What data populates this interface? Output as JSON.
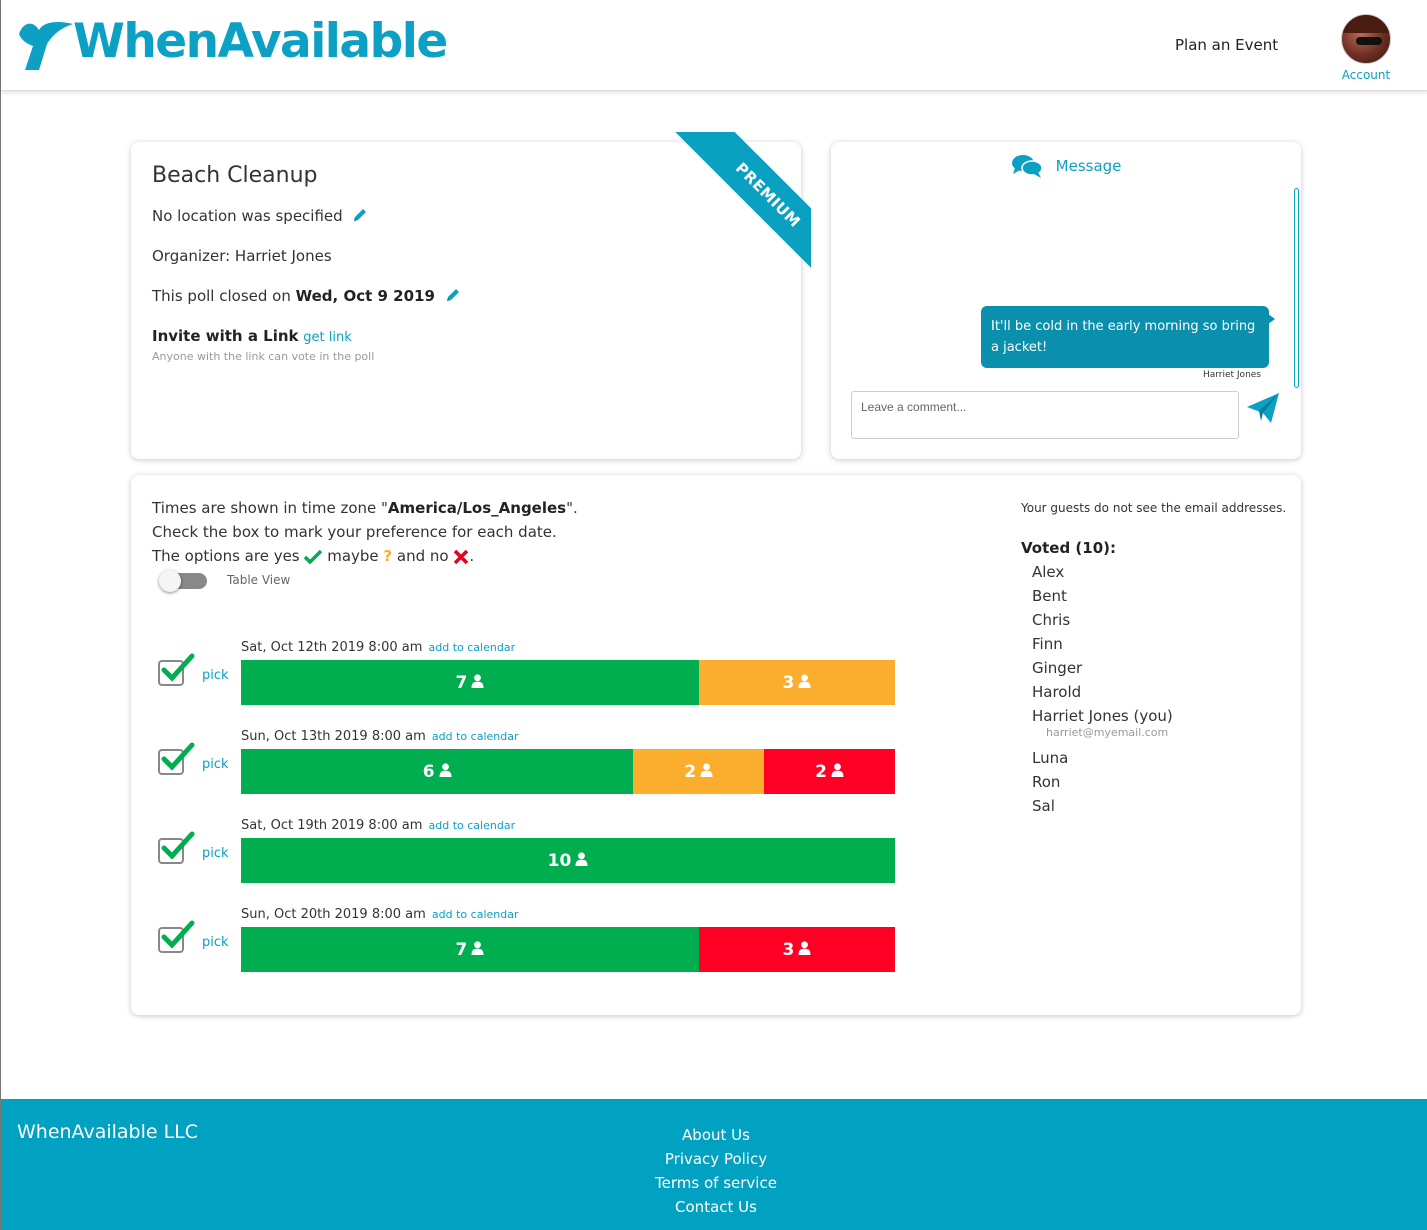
{
  "header": {
    "brand": "WhenAvailable",
    "nav_plan": "Plan an Event",
    "account_label": "Account"
  },
  "event": {
    "title": "Beach Cleanup",
    "location": "No location was specified",
    "organizer": "Organizer: Harriet Jones",
    "closed_prefix": "This poll closed on",
    "closed_date": "Wed, Oct 9 2019",
    "invite_label": "Invite with a Link",
    "invite_link": "get link",
    "invite_note": "Anyone with the link can vote in the poll",
    "badge": "PREMIUM"
  },
  "messages": {
    "title": "Message",
    "items": [
      {
        "text": "It'll be cold in the early morning so bring a jacket!",
        "author": "Harriet Jones"
      }
    ],
    "comment_placeholder": "Leave a comment..."
  },
  "poll": {
    "tz_prefix": "Times are shown in time zone \"",
    "tz_name": "America/Los_Angeles",
    "tz_suffix": "\".",
    "instructions": "Check the box to mark your preference for each date.",
    "options_prefix": "The options are yes",
    "options_maybe": "maybe",
    "options_no": "and no",
    "options_end": ".",
    "table_view_label": "Table View",
    "table_view_on": false,
    "pick_label": "pick",
    "calendar_label": "add to calendar",
    "dates": [
      {
        "label": "Sat, Oct 12th 2019 8:00 am",
        "picked": true,
        "yes": 7,
        "maybe": 3,
        "no": 0
      },
      {
        "label": "Sun, Oct 13th 2019 8:00 am",
        "picked": true,
        "yes": 6,
        "maybe": 2,
        "no": 2
      },
      {
        "label": "Sat, Oct 19th 2019 8:00 am",
        "picked": true,
        "yes": 10,
        "maybe": 0,
        "no": 0
      },
      {
        "label": "Sun, Oct 20th 2019 8:00 am",
        "picked": true,
        "yes": 7,
        "maybe": 0,
        "no": 3
      }
    ]
  },
  "guests": {
    "note": "Your guests do not see the email addresses.",
    "voted_title": "Voted (10):",
    "list": [
      {
        "name": "Alex"
      },
      {
        "name": "Bent"
      },
      {
        "name": "Chris"
      },
      {
        "name": "Finn"
      },
      {
        "name": "Ginger"
      },
      {
        "name": "Harold"
      },
      {
        "name": "Harriet Jones (you)",
        "email": "harriet@myemail.com"
      },
      {
        "name": "Luna"
      },
      {
        "name": "Ron"
      },
      {
        "name": "Sal"
      }
    ]
  },
  "footer": {
    "company": "WhenAvailable LLC",
    "links": [
      "About Us",
      "Privacy Policy",
      "Terms of service",
      "Contact Us"
    ]
  },
  "colors": {
    "brand": "#0ba0c4",
    "yes": "#00ad4f",
    "maybe": "#fbad2d",
    "no": "#ff0025",
    "footer": "#00a1c1"
  }
}
